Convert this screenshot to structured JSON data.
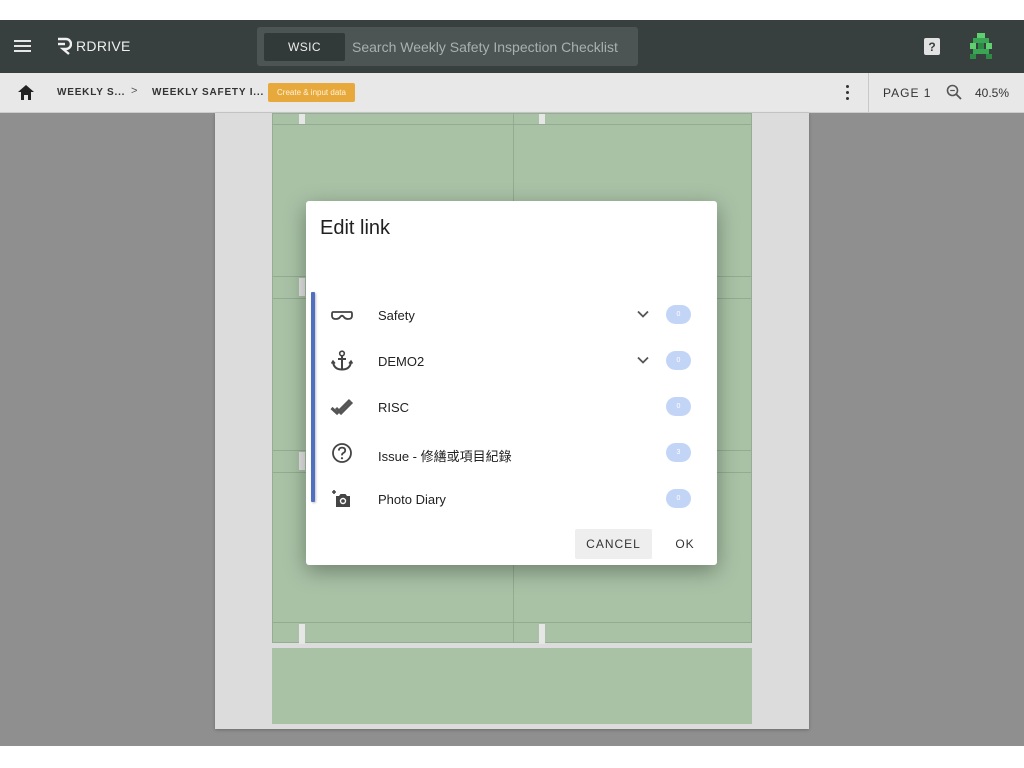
{
  "app": {
    "logo_text": "RDRIVE",
    "accent": "#37403f"
  },
  "search": {
    "scope_chip": "WSIC",
    "placeholder": "Search Weekly Safety Inspection Checklist"
  },
  "header": {
    "help_glyph": "?",
    "icons": [
      "menu-icon",
      "logo-icon",
      "help-icon",
      "avatar"
    ]
  },
  "breadcrumb": {
    "items": [
      {
        "label": "WEEKLY S..."
      },
      {
        "label": "WEEKLY SAFETY I..."
      }
    ],
    "separator": ">",
    "badge": "Create & input data",
    "badge_color": "#e7a93c",
    "page": "PAGE 1",
    "zoom": "40.5%"
  },
  "dialog": {
    "title": "Edit link",
    "rail_color": "#4f6fc0",
    "items": [
      {
        "label": "Safety",
        "icon": "goggles-icon",
        "has_dropdown": true,
        "count": "0"
      },
      {
        "label": "DEMO2",
        "icon": "anchor-icon",
        "has_dropdown": true,
        "count": "0"
      },
      {
        "label": "RISC",
        "icon": "double-check-icon",
        "has_dropdown": false,
        "count": "0"
      },
      {
        "label": "Issue - 修繕或項目紀錄",
        "icon": "help-circle-icon",
        "has_dropdown": false,
        "count": "3"
      },
      {
        "label": "Photo Diary",
        "icon": "add-camera-icon",
        "has_dropdown": false,
        "count": "0"
      }
    ],
    "cancel_label": "CANCEL",
    "ok_label": "OK"
  }
}
